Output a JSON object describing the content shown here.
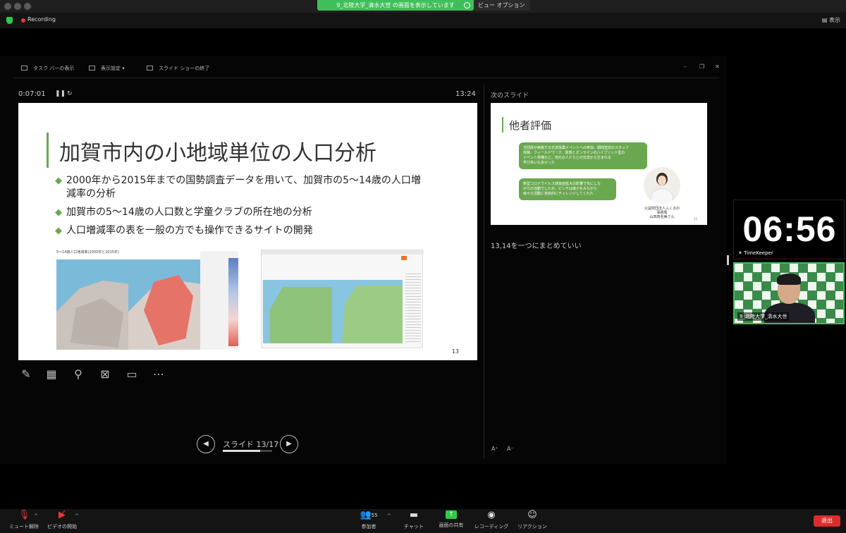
{
  "share_banner": {
    "text": "9_北陸大学_清水大世 の画面を表示しています",
    "view_options": "ビュー オプション ⌄"
  },
  "topbar": {
    "recording": "Recording",
    "view": "表示"
  },
  "presenter": {
    "toolbar": {
      "taskbar": "タスク バーの表示",
      "display": "表示設定 ▾",
      "end_show": "スライド ショーの終了"
    },
    "elapsed": "0:07:01",
    "clock": "13:24",
    "next_label": "次のスライド",
    "slide_counter": "スライド 13/17",
    "progress": 0.76,
    "notes": "13,14を一つにまとめていい",
    "font_up": "A⁺",
    "font_down": "A⁻"
  },
  "slide": {
    "title": "加賀市内の小地域単位の人口分析",
    "bullets": [
      "2000年から2015年までの国勢調査データを用いて、加賀市の5～14歳の人口増減率の分析",
      "加賀市の5～14歳の人口数と学童クラブの所在地の分析",
      "人口増減率の表を一般の方でも操作できるサイトの開発"
    ],
    "map_left_title": "5～14歳人口増減率(2000年と2015年)",
    "page_number": "13"
  },
  "next_slide": {
    "title": "他者評価",
    "bubble1": [
      "当団体が実施する交流事業イベントへの参加、期間直前のスタッフ",
      "体験、フィールドワーク、質感とオンラインのハイブリッド型の",
      "イベント準備など。地元の人たちとの交流から生まれる",
      "学びあいも多かった"
    ],
    "bubble2": [
      "新型コロナウイルス感染症拡大の影響で先にしな",
      "がらの活動でしたが、ピンチは様子をみながら",
      "様々な活動に意欲的にチャレンジしてくれた"
    ],
    "caption": [
      "公益財団法人ふくるの",
      "事務局",
      "山田真名美さん"
    ],
    "page_number": "15"
  },
  "timekeeper": {
    "time": "06:56",
    "name": "TimeKeeper"
  },
  "camera": {
    "name": "9_北陸大学_清水大世"
  },
  "bottombar": {
    "mute": "ミュート解除",
    "video": "ビデオの開始",
    "participants": "参加者",
    "participants_count": "55",
    "chat": "チャット",
    "share": "画面の共有",
    "record": "レコーディング",
    "reactions": "リアクション",
    "leave": "退出"
  },
  "colors": {
    "accent_green": "#6aa84f",
    "zoom_green": "#2ecc4a",
    "leave_red": "#d92d2d"
  }
}
